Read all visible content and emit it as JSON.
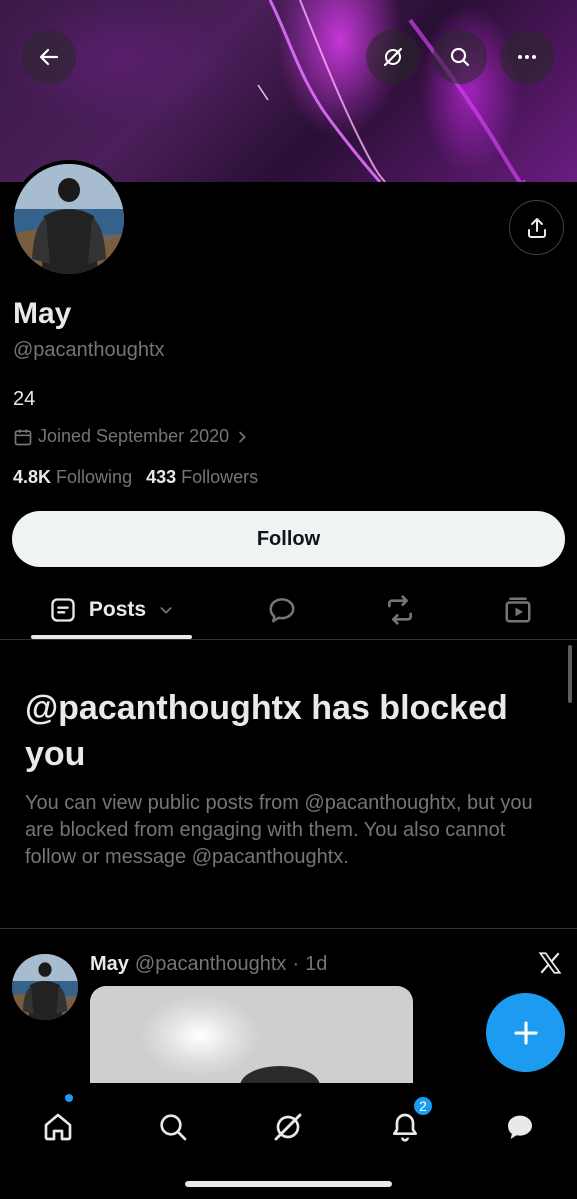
{
  "profile": {
    "display_name": "May",
    "handle": "@pacanthoughtx",
    "bio": "24",
    "joined": "Joined September 2020",
    "following_count": "4.8K",
    "following_label": "Following",
    "followers_count": "433",
    "followers_label": "Followers"
  },
  "header": {
    "back_icon": "arrow-left-icon",
    "grok_icon": "grok-icon",
    "search_icon": "search-icon",
    "more_icon": "more-horizontal-icon",
    "share_icon": "share-icon"
  },
  "follow_button": {
    "label": "Follow"
  },
  "tabs": [
    {
      "label": "Posts",
      "icon": "posts-icon",
      "active": true
    },
    {
      "label": "",
      "icon": "replies-icon"
    },
    {
      "label": "",
      "icon": "reposts-icon"
    },
    {
      "label": "",
      "icon": "media-icon"
    }
  ],
  "blocked_notice": {
    "title": "@pacanthoughtx has blocked you",
    "description": "You can view public posts from @pacanthoughtx, but you are blocked from engaging with them. You also cannot follow or message @pacanthoughtx."
  },
  "post": {
    "author": "May",
    "handle": "@pacanthoughtx",
    "separator": "·",
    "time": "1d"
  },
  "bottom_nav": {
    "items": [
      "home-icon",
      "search-icon",
      "grok-icon",
      "notifications-icon",
      "messages-icon"
    ],
    "notification_count": "2"
  },
  "colors": {
    "accent": "#1d9bf0",
    "background": "#000000",
    "text_primary": "#e7e9ea",
    "text_secondary": "#71767b"
  }
}
